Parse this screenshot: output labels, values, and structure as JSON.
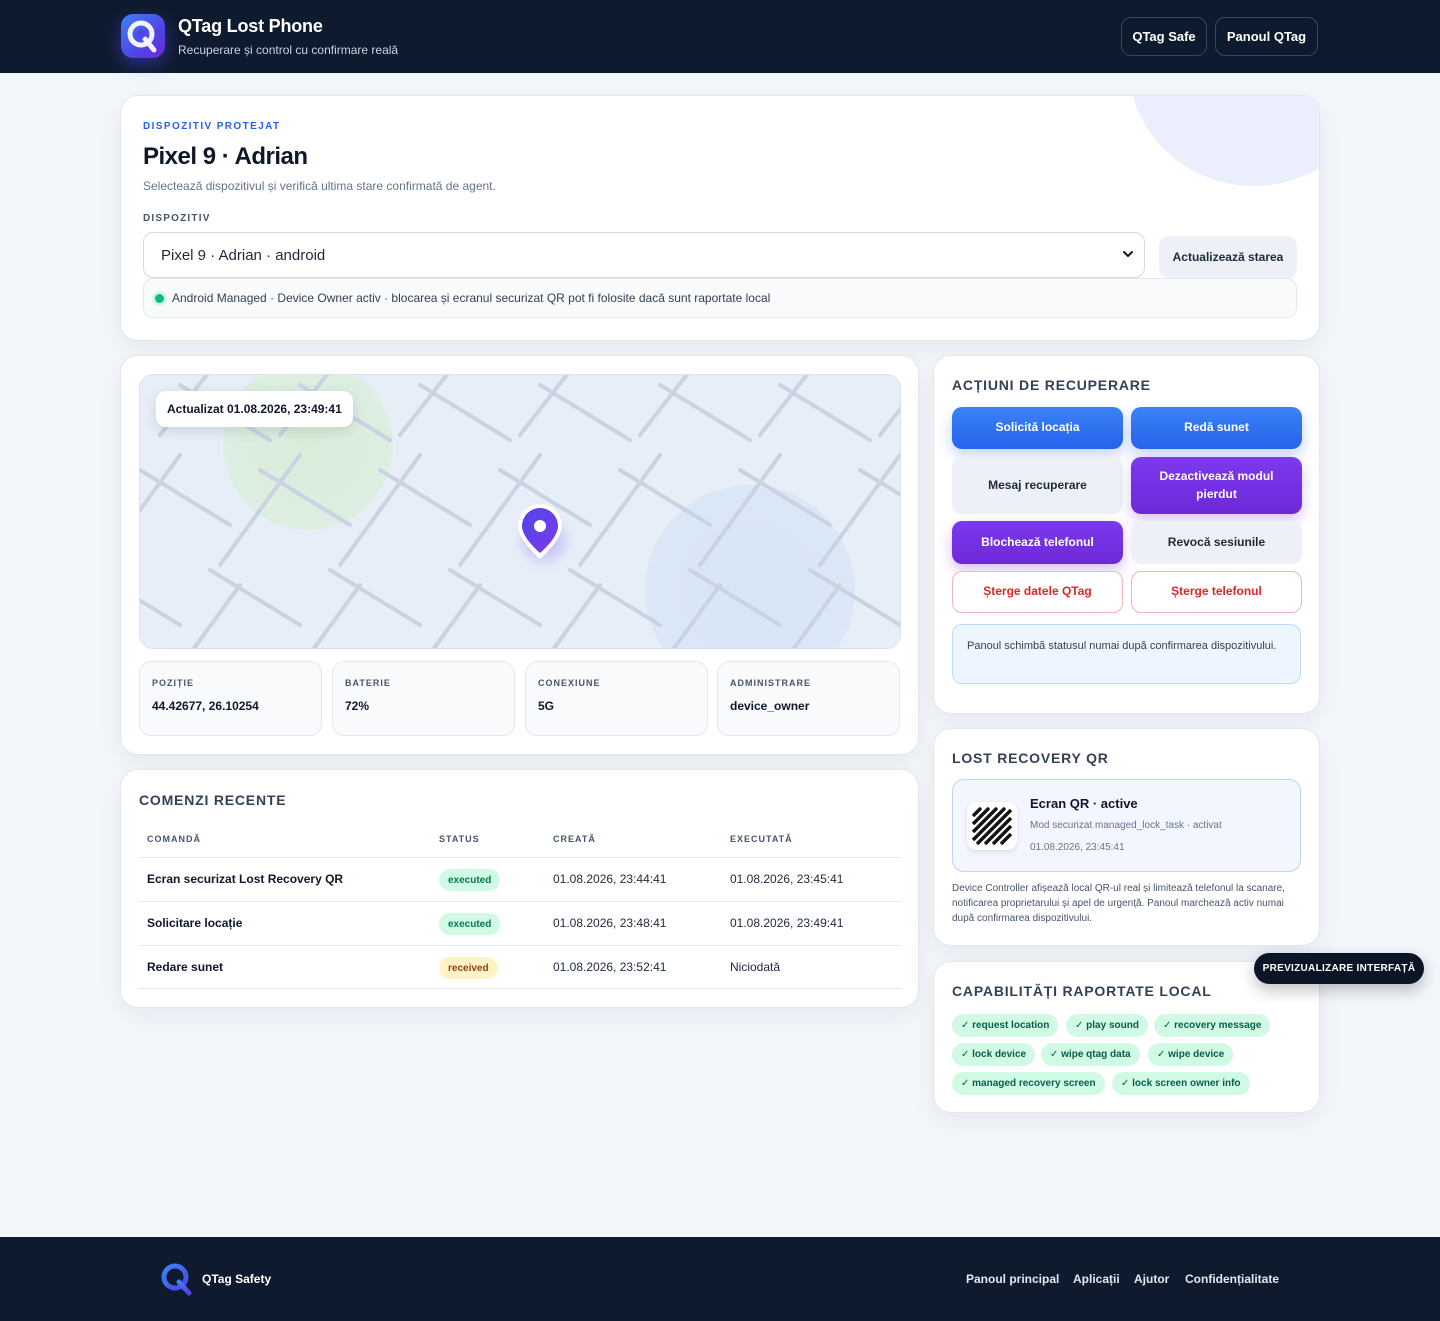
{
  "header": {
    "title": "QTag Lost Phone",
    "subtitle": "Recuperare și control cu confirmare reală",
    "nav": [
      "QTag Safe",
      "Panoul QTag"
    ]
  },
  "device": {
    "eyebrow": "DISPOZITIV PROTEJAT",
    "name": "Pixel 9 · Adrian",
    "description": "Selectează dispozitivul și verifică ultima stare confirmată de agent.",
    "select_label": "DISPOZITIV",
    "selected_value": "Pixel 9 · Adrian · android",
    "refresh_label": "Actualizează starea",
    "status_text": "Android Managed · Device Owner activ · blocarea și ecranul securizat QR pot fi folosite dacă sunt raportate local"
  },
  "map": {
    "updated": "Actualizat 01.08.2026, 23:49:41",
    "stats": [
      {
        "key": "POZIȚIE",
        "value": "44.42677, 26.10254"
      },
      {
        "key": "BATERIE",
        "value": "72%"
      },
      {
        "key": "CONEXIUNE",
        "value": "5G"
      },
      {
        "key": "ADMINISTRARE",
        "value": "device_owner"
      }
    ]
  },
  "actions": {
    "title": "ACȚIUNI DE RECUPERARE",
    "buttons": [
      "Solicită locația",
      "Redă sunet",
      "Mesaj recuperare",
      "Dezactivează modul pierdut",
      "Blochează telefonul",
      "Revocă sesiunile",
      "Șterge datele QTag",
      "Șterge telefonul"
    ],
    "notice": "Panoul schimbă statusul numai după confirmarea dispozitivului."
  },
  "commands": {
    "title": "COMENZI RECENTE",
    "columns": [
      "COMANDĂ",
      "STATUS",
      "CREATĂ",
      "EXECUTATĂ"
    ],
    "rows": [
      {
        "command": "Ecran securizat Lost Recovery QR",
        "status": "executed",
        "created": "01.08.2026, 23:44:41",
        "executed": "01.08.2026, 23:45:41"
      },
      {
        "command": "Solicitare locație",
        "status": "executed",
        "created": "01.08.2026, 23:48:41",
        "executed": "01.08.2026, 23:49:41"
      },
      {
        "command": "Redare sunet",
        "status": "received",
        "created": "01.08.2026, 23:52:41",
        "executed": "Niciodată"
      }
    ]
  },
  "qr": {
    "title": "LOST RECOVERY QR",
    "screen_title": "Ecran QR · active",
    "mode": "Mod securizat managed_lock_task · activat",
    "time": "01.08.2026, 23:45:41",
    "body": "Device Controller afișează local QR-ul real și limitează telefonul la scanare, notificarea proprietarului și apel de urgență. Panoul marchează activ numai după confirmarea dispozitivului."
  },
  "capabilities": {
    "title": "CAPABILITĂȚI RAPORTATE LOCAL",
    "items": [
      "✓ request location",
      "✓ play sound",
      "✓ recovery message",
      "✓ lock device",
      "✓ wipe qtag data",
      "✓ wipe device",
      "✓ managed recovery screen",
      "✓ lock screen owner info"
    ]
  },
  "preview_badge": "PREVIZUALIZARE INTERFAȚĂ",
  "footer": {
    "brand": "QTag Safety",
    "links": [
      "Panoul principal",
      "Aplicații",
      "Ajutor",
      "Confidențialitate"
    ]
  },
  "colors": {
    "navy": "#0e1a2e",
    "primary_blue": "#2563eb",
    "purple": "#6d28d9",
    "danger": "#dc2626",
    "success": "#10b981"
  },
  "icons": [
    "app-logo-icon",
    "chevron-down-icon",
    "map-pin-icon",
    "qr-code-icon"
  ]
}
